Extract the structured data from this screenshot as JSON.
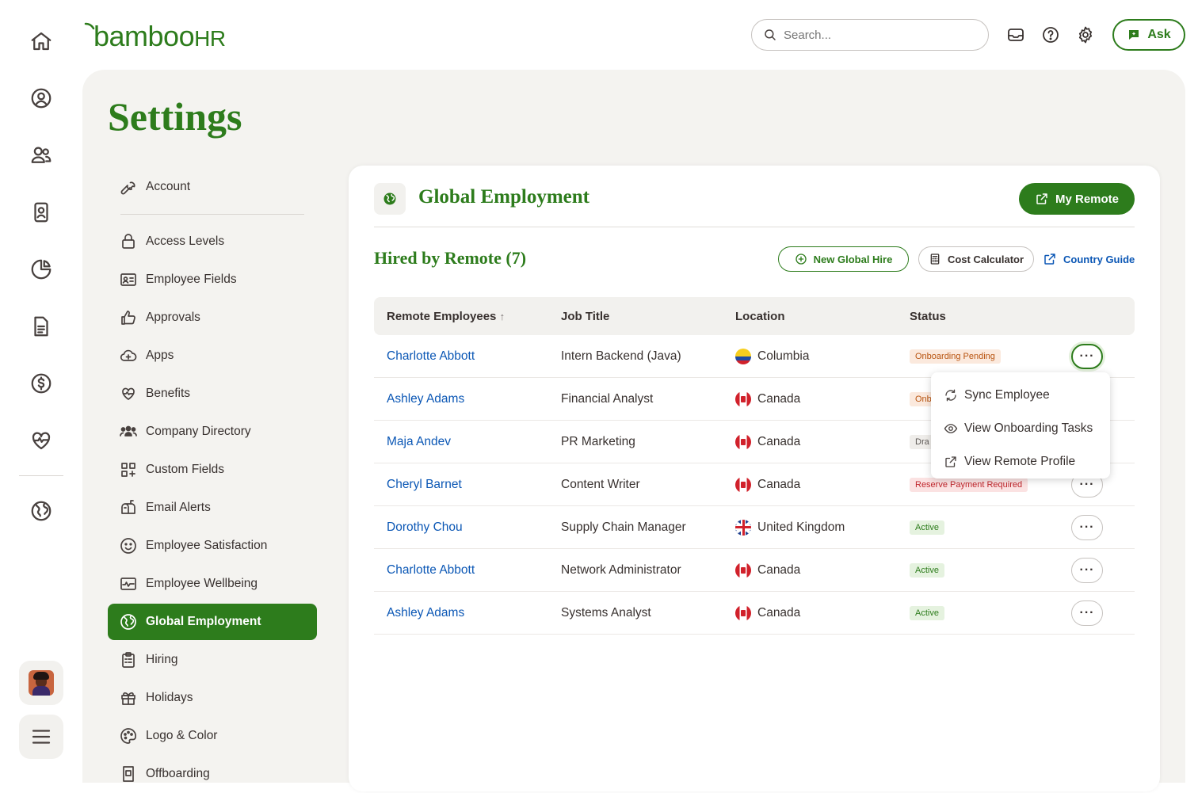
{
  "brand": {
    "logo_text": "bamboo",
    "logo_suffix": "HR",
    "accent": "#2d7c1c"
  },
  "nav": {
    "items": [
      {
        "name": "home-icon"
      },
      {
        "name": "person-circle-icon"
      },
      {
        "name": "people-icon"
      },
      {
        "name": "id-badge-icon"
      },
      {
        "name": "pie-chart-icon"
      },
      {
        "name": "document-icon"
      },
      {
        "name": "dollar-circle-icon"
      },
      {
        "name": "heart-pulse-icon"
      },
      {
        "name": "globe-icon"
      },
      {
        "name": "menu-icon"
      }
    ]
  },
  "topbar": {
    "search_placeholder": "Search...",
    "ask_label": "Ask"
  },
  "page": {
    "title": "Settings"
  },
  "sidebar": {
    "items": [
      {
        "label": "Account",
        "icon": "wrench-icon"
      },
      {
        "label": "Access Levels",
        "icon": "lock-icon"
      },
      {
        "label": "Employee Fields",
        "icon": "id-card-icon"
      },
      {
        "label": "Approvals",
        "icon": "thumbs-up-icon"
      },
      {
        "label": "Apps",
        "icon": "cloud-plus-icon"
      },
      {
        "label": "Benefits",
        "icon": "heart-hand-icon"
      },
      {
        "label": "Company Directory",
        "icon": "people-group-icon"
      },
      {
        "label": "Custom Fields",
        "icon": "grid-plus-icon"
      },
      {
        "label": "Email Alerts",
        "icon": "mailbox-icon"
      },
      {
        "label": "Employee Satisfaction",
        "icon": "smile-icon"
      },
      {
        "label": "Employee Wellbeing",
        "icon": "pulse-icon"
      },
      {
        "label": "Global Employment",
        "icon": "globe-icon",
        "active": true
      },
      {
        "label": "Hiring",
        "icon": "clipboard-icon"
      },
      {
        "label": "Holidays",
        "icon": "gift-icon"
      },
      {
        "label": "Logo & Color",
        "icon": "palette-icon"
      },
      {
        "label": "Offboarding",
        "icon": "door-icon"
      }
    ]
  },
  "card": {
    "title": "Global Employment",
    "my_remote_label": "My Remote",
    "subtitle": "Hired by Remote (7)",
    "new_hire_label": "New Global Hire",
    "cost_calc_label": "Cost Calculator",
    "country_guide_label": "Country Guide"
  },
  "table": {
    "headers": [
      "Remote Employees",
      "Job Title",
      "Location",
      "Status"
    ],
    "sort_indicator": "↑",
    "rows": [
      {
        "name": "Charlotte Abbott",
        "job": "Intern Backend (Java)",
        "location": "Columbia",
        "flag": "co",
        "status": "Onboarding Pending",
        "status_color": "orange"
      },
      {
        "name": "Ashley Adams",
        "job": "Financial Analyst",
        "location": "Canada",
        "flag": "ca",
        "status": "Onb",
        "status_color": "orange"
      },
      {
        "name": "Maja Andev",
        "job": "PR Marketing",
        "location": "Canada",
        "flag": "ca",
        "status": "Dra",
        "status_color": "grey"
      },
      {
        "name": "Cheryl Barnet",
        "job": "Content Writer",
        "location": "Canada",
        "flag": "ca",
        "status": "Reserve Payment Required",
        "status_color": "red"
      },
      {
        "name": "Dorothy Chou",
        "job": "Supply Chain Manager",
        "location": "United Kingdom",
        "flag": "gb",
        "status": "Active",
        "status_color": "green"
      },
      {
        "name": "Charlotte Abbott",
        "job": "Network Administrator",
        "location": "Canada",
        "flag": "ca",
        "status": "Active",
        "status_color": "green"
      },
      {
        "name": "Ashley Adams",
        "job": "Systems Analyst",
        "location": "Canada",
        "flag": "ca",
        "status": "Active",
        "status_color": "green"
      }
    ]
  },
  "dropdown": {
    "items": [
      {
        "label": "Sync Employee",
        "icon": "sync-icon"
      },
      {
        "label": "View Onboarding Tasks",
        "icon": "eye-icon"
      },
      {
        "label": "View Remote Profile",
        "icon": "external-link-icon"
      }
    ]
  }
}
